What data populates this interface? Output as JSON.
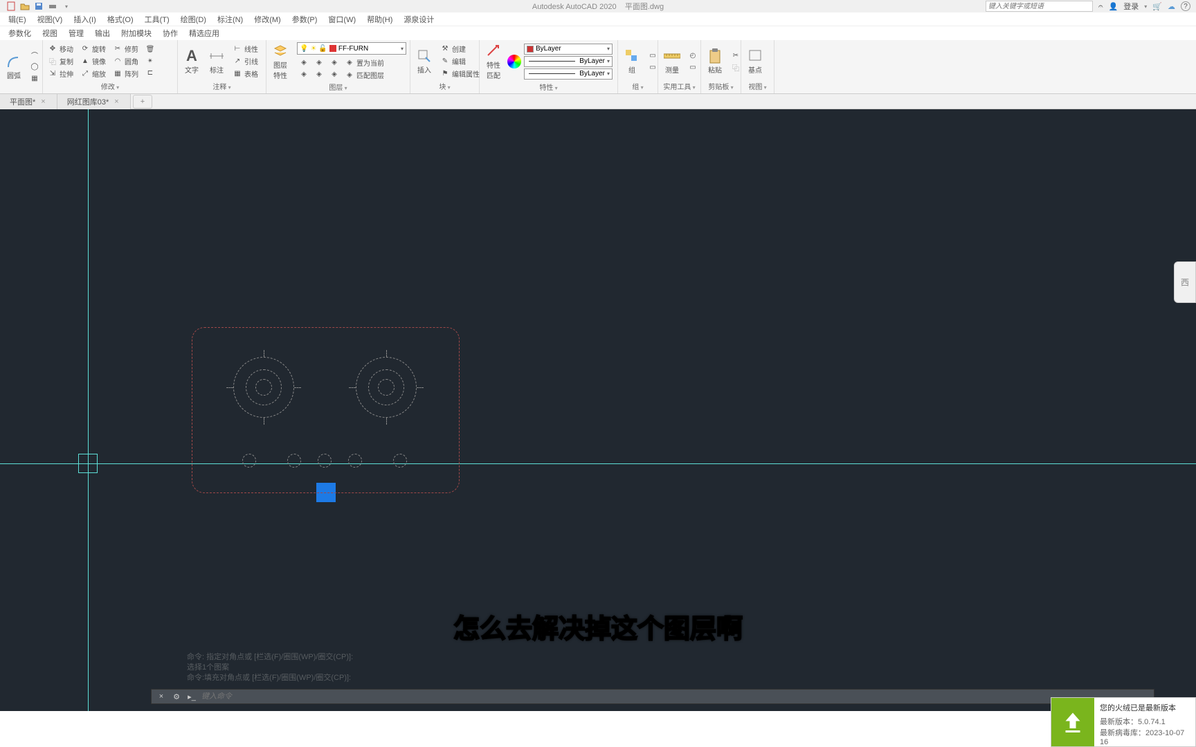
{
  "title_bar": {
    "app_name": "Autodesk AutoCAD 2020",
    "file_name": "平面图.dwg",
    "search_placeholder": "键入关键字或短语",
    "login": "登录"
  },
  "menu": {
    "items": [
      "辑(E)",
      "视图(V)",
      "插入(I)",
      "格式(O)",
      "工具(T)",
      "绘图(D)",
      "标注(N)",
      "修改(M)",
      "参数(P)",
      "窗口(W)",
      "帮助(H)",
      "源泉设计"
    ]
  },
  "ribbon_tabs": {
    "items": [
      "参数化",
      "视图",
      "管理",
      "输出",
      "附加模块",
      "协作",
      "精选应用"
    ]
  },
  "ribbon": {
    "p1": {
      "btn1": "圆弧"
    },
    "p2": {
      "label": "修改",
      "move": "移动",
      "copy": "复制",
      "stretch": "拉伸",
      "rotate": "旋转",
      "mirror": "镜像",
      "scale": "缩放",
      "trim": "修剪",
      "fillet": "圆角",
      "array": "阵列"
    },
    "p3": {
      "label": "注释",
      "text": "文字",
      "dim": "标注",
      "linear": "线性",
      "leader": "引线",
      "table": "表格"
    },
    "p4": {
      "label": "图层",
      "props": "图层\n特性",
      "current": "置为当前",
      "match": "匹配图层",
      "layer_name": "FF-FURN"
    },
    "p5": {
      "label": "块",
      "insert": "插入",
      "create": "创建",
      "edit": "编辑",
      "editattr": "编辑属性"
    },
    "p6": {
      "label": "特性",
      "props": "特性\n匹配",
      "bylayer": "ByLayer"
    },
    "p7": {
      "label": "组",
      "group": "组"
    },
    "p8": {
      "label": "实用工具",
      "measure": "测量"
    },
    "p9": {
      "label": "剪贴板",
      "paste": "粘贴"
    },
    "p10": {
      "label": "视图",
      "base": "基点"
    }
  },
  "file_tabs": {
    "t1": "平面图*",
    "t2": "网红图库03*"
  },
  "subtitle_text": "怎么去解决掉这个图层啊",
  "cmd_hints": {
    "l1": "命令: 指定对角点或 [栏选(F)/圈围(WP)/圈交(CP)]:",
    "l2": "选择1个图案",
    "l3": "命令:填充对角点或 [栏选(F)/圈围(WP)/圈交(CP)]:"
  },
  "command": {
    "placeholder": "键入命令"
  },
  "notification": {
    "title": "您的火绒已是最新版本",
    "version_label": "最新版本：",
    "version": "5.0.74.1",
    "db_label": "最新病毒库：",
    "db": "2023-10-07 16"
  },
  "side_badge": "西"
}
